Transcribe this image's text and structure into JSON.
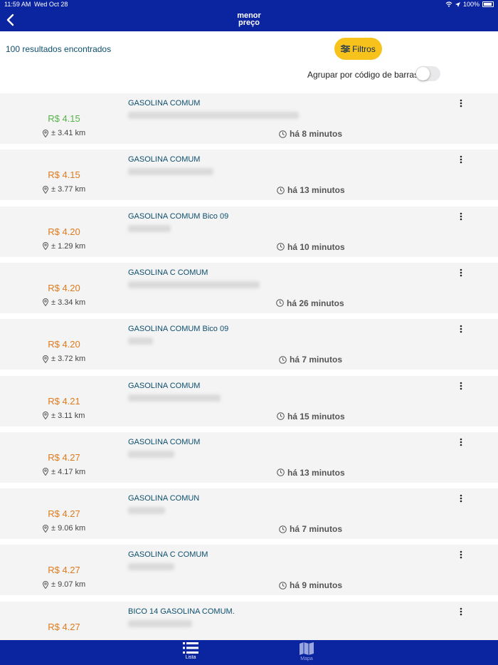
{
  "status_bar": {
    "time": "11:59 AM",
    "date": "Wed Oct 28",
    "battery": "100%"
  },
  "header": {
    "logo_line1": "menor",
    "logo_line2": "preço"
  },
  "results_text": "100 resultados encontrados",
  "filter_button": "Filtros",
  "group_toggle": {
    "label": "Agrupar por código de barras",
    "on": false
  },
  "results": [
    {
      "price": "R$ 4.15",
      "distance": "± 3.41 km",
      "product": "GASOLINA COMUM",
      "time_ago": "há 8 minutos",
      "best": true
    },
    {
      "price": "R$ 4.15",
      "distance": "± 3.77 km",
      "product": "GASOLINA COMUM",
      "time_ago": "há 13 minutos",
      "best": false
    },
    {
      "price": "R$ 4.20",
      "distance": "± 1.29 km",
      "product": "GASOLINA COMUM Bico 09",
      "time_ago": "há 10 minutos",
      "best": false
    },
    {
      "price": "R$ 4.20",
      "distance": "± 3.34 km",
      "product": "GASOLINA C COMUM",
      "time_ago": "há 26 minutos",
      "best": false
    },
    {
      "price": "R$ 4.20",
      "distance": "± 3.72 km",
      "product": "GASOLINA COMUM Bico 09",
      "time_ago": "há 7 minutos",
      "best": false
    },
    {
      "price": "R$ 4.21",
      "distance": "± 3.11 km",
      "product": "GASOLINA COMUM",
      "time_ago": "há 15 minutos",
      "best": false
    },
    {
      "price": "R$ 4.27",
      "distance": "± 4.17 km",
      "product": "GASOLINA COMUM",
      "time_ago": "há 13 minutos",
      "best": false
    },
    {
      "price": "R$ 4.27",
      "distance": "± 9.06 km",
      "product": "GASOLINA COMUN",
      "time_ago": "há 7 minutos",
      "best": false
    },
    {
      "price": "R$ 4.27",
      "distance": "± 9.07 km",
      "product": "GASOLINA C COMUM",
      "time_ago": "há 9 minutos",
      "best": false
    },
    {
      "price": "R$ 4.27",
      "distance": "",
      "product": "BICO 14 GASOLINA COMUM.",
      "time_ago": "",
      "best": false
    }
  ],
  "tabs": [
    {
      "label": "Lista",
      "icon": "list-icon",
      "active": true
    },
    {
      "label": "Mapa",
      "icon": "map-icon",
      "active": false
    }
  ],
  "colors": {
    "brand_blue": "#0b24a0",
    "accent_yellow": "#f7c21b",
    "best_price_green": "#53b348",
    "price_orange": "#e07a1c"
  }
}
